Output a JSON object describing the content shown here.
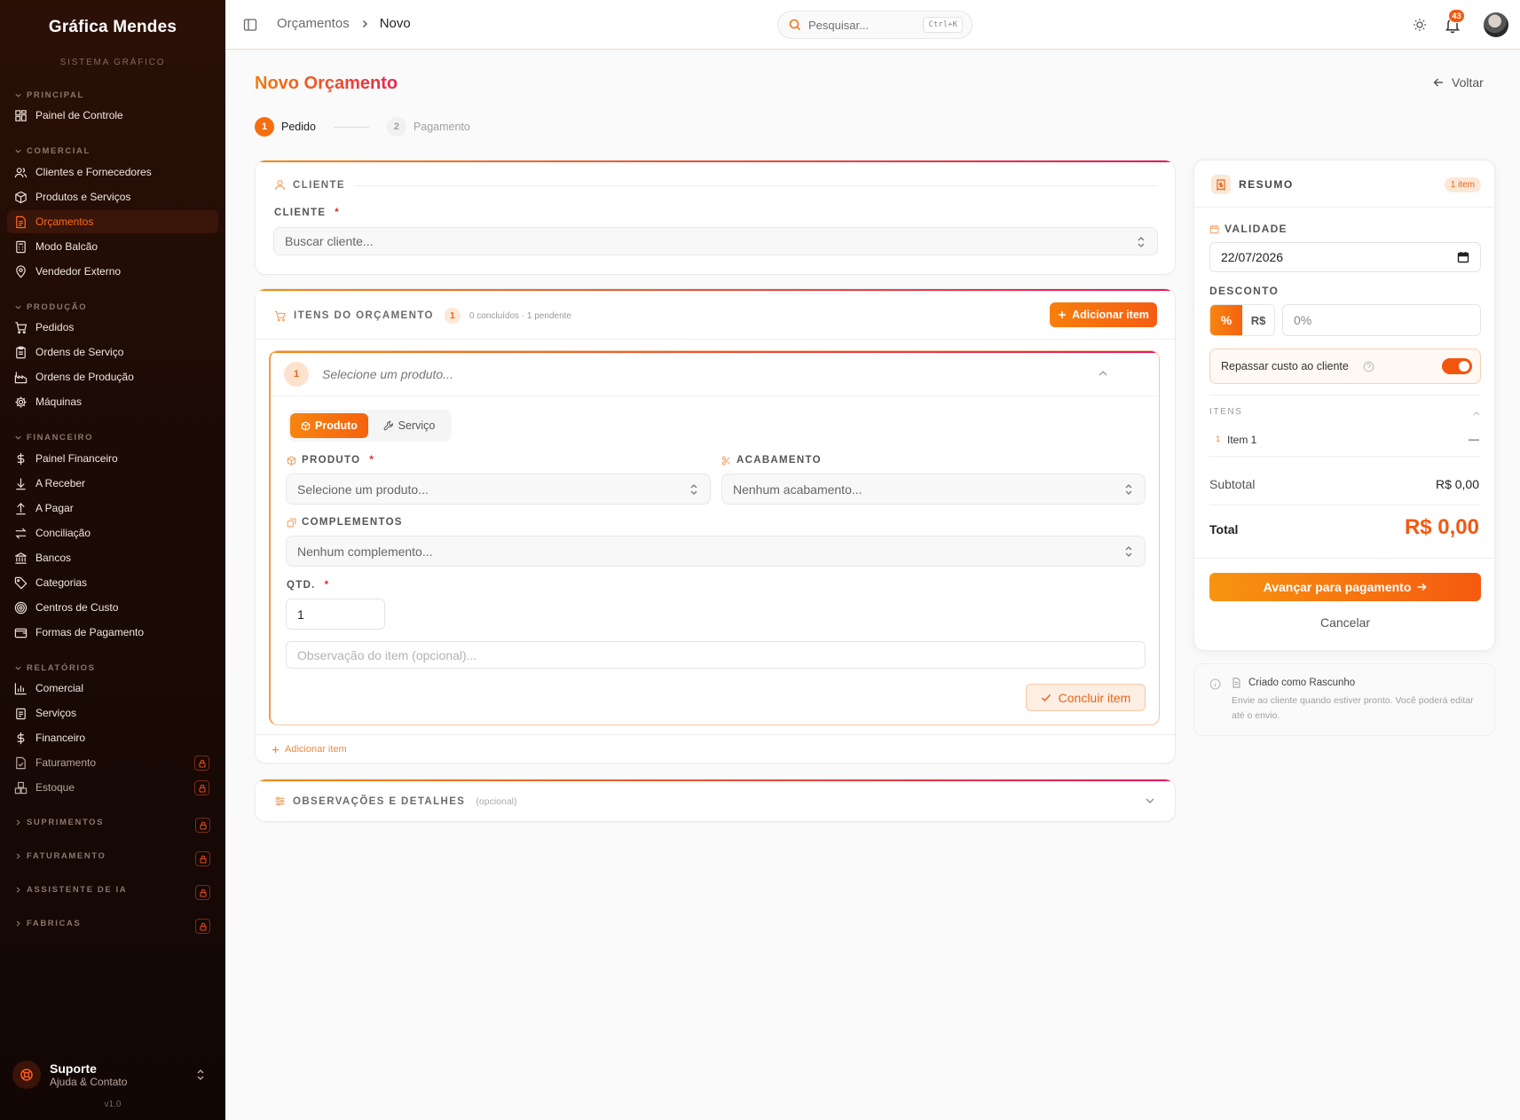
{
  "brand": {
    "name": "Gráfica Mendes",
    "subtitle": "SISTEMA GRÁFICO"
  },
  "sidebar": {
    "sections": {
      "principal": "PRINCIPAL",
      "comercial": "COMERCIAL",
      "producao": "PRODUÇÃO",
      "financeiro": "FINANCEIRO",
      "relatorios": "RELATÓRIOS",
      "suprimentos": "SUPRIMENTOS",
      "faturamento": "FATURAMENTO",
      "assistente": "ASSISTENTE DE IA",
      "fabricas": "FABRICAS"
    },
    "items": {
      "painel": "Painel de Controle",
      "clientes": "Clientes e Fornecedores",
      "produtos": "Produtos e Serviços",
      "orcamentos": "Orçamentos",
      "balcao": "Modo Balcão",
      "vendedor": "Vendedor Externo",
      "pedidos": "Pedidos",
      "os": "Ordens de Serviço",
      "op": "Ordens de Produção",
      "maquinas": "Máquinas",
      "painel_fin": "Painel Financeiro",
      "receber": "A Receber",
      "pagar": "A Pagar",
      "conciliacao": "Conciliação",
      "bancos": "Bancos",
      "categorias": "Categorias",
      "centros": "Centros de Custo",
      "formas": "Formas de Pagamento",
      "rel_comercial": "Comercial",
      "rel_servicos": "Serviços",
      "rel_financeiro": "Financeiro",
      "rel_faturamento": "Faturamento",
      "rel_estoque": "Estoque"
    },
    "support": {
      "title": "Suporte",
      "subtitle": "Ajuda & Contato"
    },
    "version": "v1.0"
  },
  "topbar": {
    "breadcrumb": [
      "Orçamentos",
      "Novo"
    ],
    "search_placeholder": "Pesquisar...",
    "search_shortcut": "Ctrl+K",
    "notification_count": "43"
  },
  "page": {
    "title": "Novo Orçamento",
    "back_label": "Voltar",
    "steps": [
      {
        "n": "1",
        "label": "Pedido"
      },
      {
        "n": "2",
        "label": "Pagamento"
      }
    ]
  },
  "client_card": {
    "section": "CLIENTE",
    "field_label": "CLIENTE",
    "placeholder": "Buscar cliente..."
  },
  "items_card": {
    "section": "ITENS DO ORÇAMENTO",
    "count": "1",
    "status": "0 concluídos · 1 pendente",
    "add_button": "Adicionar item",
    "add_link": "Adicionar item",
    "item": {
      "number": "1",
      "title_placeholder": "Selecione um produto...",
      "type_product": "Produto",
      "type_service": "Serviço",
      "product_label": "PRODUTO",
      "product_placeholder": "Selecione um produto...",
      "finish_label": "ACABAMENTO",
      "finish_placeholder": "Nenhum acabamento...",
      "complements_label": "COMPLEMENTOS",
      "complements_placeholder": "Nenhum complemento...",
      "qty_label": "QTD.",
      "qty_value": "1",
      "note_placeholder": "Observação do item (opcional)...",
      "done_button": "Concluir item"
    }
  },
  "notes_card": {
    "section": "OBSERVAÇÕES E DETALHES",
    "hint": "(opcional)"
  },
  "summary": {
    "title": "RESUMO",
    "badge": "1 item",
    "validity_label": "VALIDADE",
    "validity_value": "22/07/2026",
    "discount_label": "DESCONTO",
    "discount_pct": "%",
    "discount_brl": "R$",
    "discount_placeholder": "0%",
    "pass_cost_label": "Repassar custo ao cliente",
    "items_label": "ITENS",
    "item_num": "1",
    "item_name": "Item 1",
    "item_value": "—",
    "subtotal_label": "Subtotal",
    "subtotal_value": "R$ 0,00",
    "total_label": "Total",
    "total_value": "R$ 0,00",
    "proceed_button": "Avançar para pagamento",
    "cancel": "Cancelar"
  },
  "draft_note": {
    "title": "Criado como Rascunho",
    "text": "Envie ao cliente quando estiver pronto. Você poderá editar até o envio."
  },
  "colors": {
    "accent": "#f56e0f",
    "accent_end": "#e8175a",
    "sidebar_bg": "#1d0b05"
  }
}
